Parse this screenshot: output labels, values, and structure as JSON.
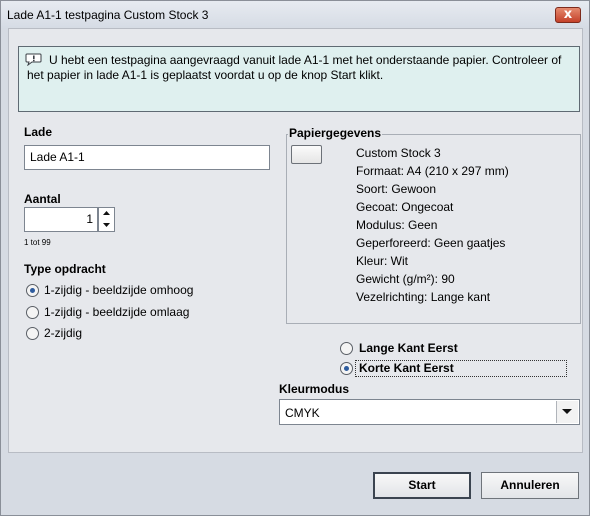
{
  "window": {
    "title": "Lade A1-1 testpagina Custom Stock 3",
    "close_glyph": "x"
  },
  "info": {
    "icon": "speech-bubble-info-icon",
    "message": "U hebt een testpagina aangevraagd vanuit lade A1-1 met het onderstaande papier.  Controleer of het papier in lade A1-1 is geplaatst voordat u op de knop Start klikt."
  },
  "lade": {
    "label": "Lade",
    "value": "Lade A1-1"
  },
  "aantal": {
    "label": "Aantal",
    "value": "1",
    "range": "1 tot 99"
  },
  "type_opdracht": {
    "label": "Type opdracht",
    "options": [
      {
        "label": "1-zijdig - beeldzijde omhoog",
        "selected": true
      },
      {
        "label": "1-zijdig - beeldzijde omlaag",
        "selected": false
      },
      {
        "label": "2-zijdig",
        "selected": false
      }
    ]
  },
  "papiergegevens": {
    "label": "Papiergegevens",
    "lines": [
      "Custom Stock 3",
      "Formaat: A4 (210 x 297 mm)",
      "Soort: Gewoon",
      "Gecoat: Ongecoat",
      "Modulus: Geen",
      "Geperforeerd: Geen gaatjes",
      "Kleur: Wit",
      "Gewicht (g/m²): 90",
      "Vezelrichting: Lange kant"
    ]
  },
  "feed": {
    "options": [
      {
        "label": "Lange Kant Eerst",
        "selected": false
      },
      {
        "label": "Korte Kant Eerst",
        "selected": true
      }
    ]
  },
  "kleurmodus": {
    "label": "Kleurmodus",
    "value": "CMYK"
  },
  "buttons": {
    "start": "Start",
    "cancel": "Annuleren"
  },
  "colors": {
    "window_bg": "#d6dbe3",
    "content_bg": "#e6e8ec",
    "info_bg": "#dff0ef",
    "close_red": "#c4412a",
    "radio_dot": "#2e5c9e"
  }
}
